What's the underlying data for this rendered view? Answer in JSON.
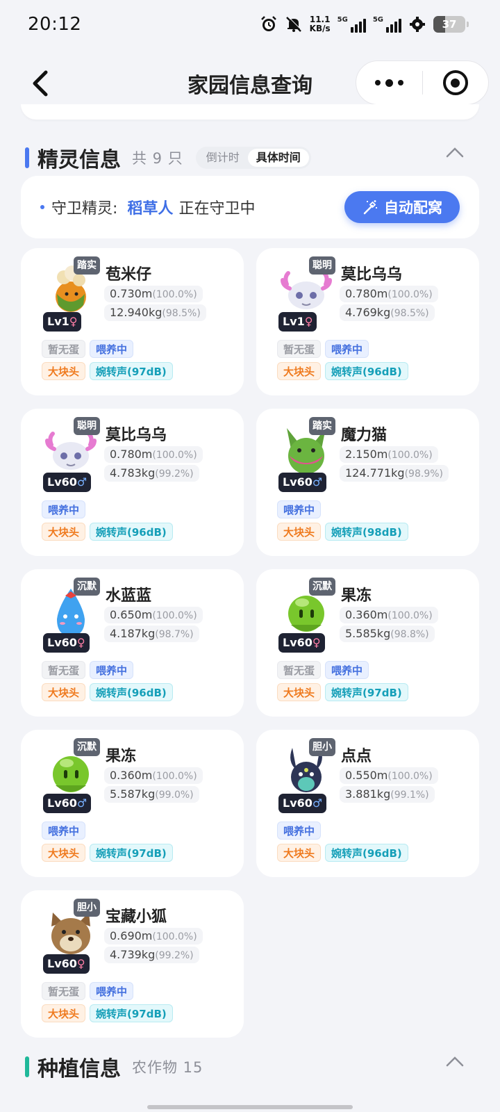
{
  "status": {
    "time": "20:12",
    "speed_top": "11.1",
    "speed_bottom": "KB/s",
    "net1": "5G",
    "net2": "5G",
    "battery": "37"
  },
  "nav": {
    "title": "家园信息查询"
  },
  "pets_section": {
    "title": "精灵信息",
    "count": "共 9 只",
    "seg": [
      "倒计时",
      "具体时间"
    ],
    "accent": "#4a78f0"
  },
  "guard": {
    "label": "守卫精灵:",
    "name": "稻草人",
    "state": "正在守卫中",
    "button": "自动配窝"
  },
  "pets": [
    {
      "name": "苞米仔",
      "trait": "踏实",
      "level": "Lv1",
      "gender": "♀",
      "height": "0.730m",
      "height_pct": "(100.0%)",
      "weight": "12.940kg",
      "weight_pct": "(98.5%)",
      "tags": [
        "暂无蛋",
        "喂养中"
      ],
      "tags2": [
        "大块头",
        "婉转声(97dB)"
      ],
      "icon": "corn-creature-icon"
    },
    {
      "name": "莫比乌乌",
      "trait": "聪明",
      "level": "Lv1",
      "gender": "♀",
      "height": "0.780m",
      "height_pct": "(100.0%)",
      "weight": "4.769kg",
      "weight_pct": "(98.5%)",
      "tags": [
        "暂无蛋",
        "喂养中"
      ],
      "tags2": [
        "大块头",
        "婉转声(96dB)"
      ],
      "icon": "axolotl-creature-icon"
    },
    {
      "name": "莫比乌乌",
      "trait": "聪明",
      "level": "Lv60",
      "gender": "♂",
      "height": "0.780m",
      "height_pct": "(100.0%)",
      "weight": "4.783kg",
      "weight_pct": "(99.2%)",
      "tags": [
        "喂养中"
      ],
      "tags2": [
        "大块头",
        "婉转声(96dB)"
      ],
      "icon": "axolotl-creature-icon"
    },
    {
      "name": "魔力猫",
      "trait": "踏实",
      "level": "Lv60",
      "gender": "♂",
      "height": "2.150m",
      "height_pct": "(100.0%)",
      "weight": "124.771kg",
      "weight_pct": "(98.9%)",
      "tags": [
        "喂养中"
      ],
      "tags2": [
        "大块头",
        "婉转声(98dB)"
      ],
      "icon": "green-cat-creature-icon"
    },
    {
      "name": "水蓝蓝",
      "trait": "沉默",
      "level": "Lv60",
      "gender": "♀",
      "height": "0.650m",
      "height_pct": "(100.0%)",
      "weight": "4.187kg",
      "weight_pct": "(98.7%)",
      "tags": [
        "暂无蛋",
        "喂养中"
      ],
      "tags2": [
        "大块头",
        "婉转声(96dB)"
      ],
      "icon": "blue-water-creature-icon"
    },
    {
      "name": "果冻",
      "trait": "沉默",
      "level": "Lv60",
      "gender": "♀",
      "height": "0.360m",
      "height_pct": "(100.0%)",
      "weight": "5.585kg",
      "weight_pct": "(98.8%)",
      "tags": [
        "暂无蛋",
        "喂养中"
      ],
      "tags2": [
        "大块头",
        "婉转声(97dB)"
      ],
      "icon": "green-jelly-creature-icon"
    },
    {
      "name": "果冻",
      "trait": "沉默",
      "level": "Lv60",
      "gender": "♂",
      "height": "0.360m",
      "height_pct": "(100.0%)",
      "weight": "5.587kg",
      "weight_pct": "(99.0%)",
      "tags": [
        "喂养中"
      ],
      "tags2": [
        "大块头",
        "婉转声(97dB)"
      ],
      "icon": "green-jelly-creature-icon"
    },
    {
      "name": "点点",
      "trait": "胆小",
      "level": "Lv60",
      "gender": "♂",
      "height": "0.550m",
      "height_pct": "(100.0%)",
      "weight": "3.881kg",
      "weight_pct": "(99.1%)",
      "tags": [
        "喂养中"
      ],
      "tags2": [
        "大块头",
        "婉转声(96dB)"
      ],
      "icon": "dark-rabbit-creature-icon"
    },
    {
      "name": "宝藏小狐",
      "trait": "胆小",
      "level": "Lv60",
      "gender": "♀",
      "height": "0.690m",
      "height_pct": "(100.0%)",
      "weight": "4.739kg",
      "weight_pct": "(99.2%)",
      "tags": [
        "暂无蛋",
        "喂养中"
      ],
      "tags2": [
        "大块头",
        "婉转声(97dB)"
      ],
      "icon": "brown-fox-creature-icon"
    }
  ],
  "plant_section": {
    "title": "种植信息",
    "sub": "农作物 15",
    "accent": "#1fb89a"
  }
}
